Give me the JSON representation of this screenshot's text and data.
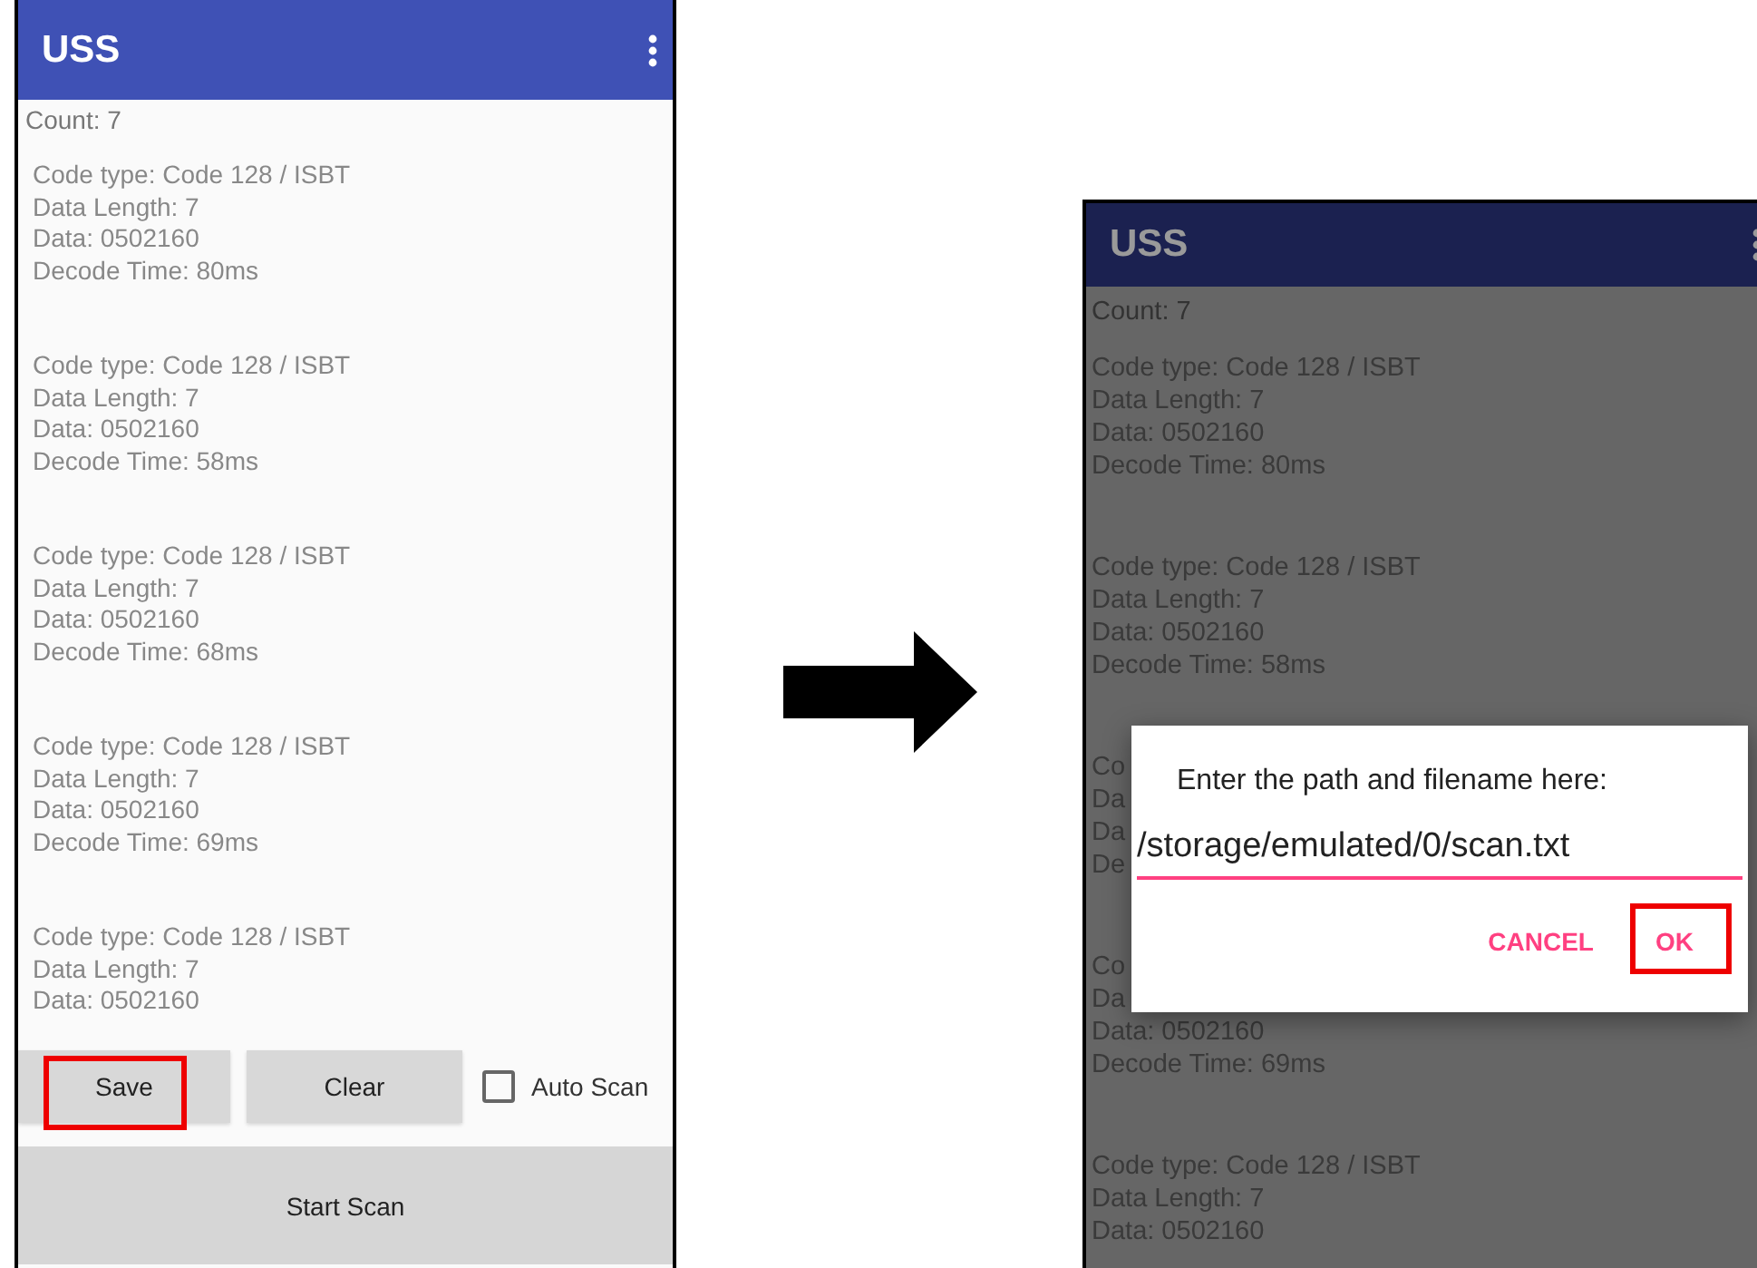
{
  "screens": [
    {
      "title": "USS",
      "dimmed": false,
      "count": "Count:  7",
      "records": [
        {
          "lines": [
            "Code type: Code 128 / ISBT",
            "Data Length: 7",
            "Data: 0502160",
            "Decode Time: 80ms"
          ]
        },
        {
          "lines": [
            "Code type: Code 128 / ISBT",
            "Data Length: 7",
            "Data: 0502160",
            "Decode Time: 58ms"
          ]
        },
        {
          "lines": [
            "Code type: Code 128 / ISBT",
            "Data Length: 7",
            "Data: 0502160",
            "Decode Time: 68ms"
          ]
        },
        {
          "lines": [
            "Code type: Code 128 / ISBT",
            "Data Length: 7",
            "Data: 0502160",
            "Decode Time: 69ms"
          ]
        },
        {
          "lines": [
            "Code type: Code 128 / ISBT",
            "Data Length: 7",
            "Data: 0502160"
          ]
        }
      ],
      "buttons": [
        {
          "label": "Save",
          "highlighted": true
        },
        {
          "label": "Clear",
          "highlighted": false
        }
      ],
      "auto_scan": {
        "label": "Auto Scan",
        "checked": false
      },
      "start_button": "Start Scan"
    },
    {
      "title": "USS",
      "dimmed": true,
      "count": "Count:  7",
      "records": [
        {
          "lines": [
            "Code type: Code 128 / ISBT",
            "Data Length: 7",
            "Data: 0502160",
            "Decode Time: 80ms"
          ]
        },
        {
          "lines": [
            "Code type: Code 128 / ISBT",
            "Data Length: 7",
            "Data: 0502160",
            "Decode Time: 58ms"
          ]
        },
        {
          "lines": [
            "Co",
            "Da",
            "Da",
            "De"
          ]
        },
        {
          "lines": [
            "Co",
            "Da",
            "Data: 0502160",
            "Decode Time: 69ms"
          ]
        },
        {
          "lines": [
            "Code type: Code 128 / ISBT",
            "Data Length: 7",
            "Data: 0502160"
          ]
        }
      ],
      "dialog": {
        "message": "Enter the path and filename here:",
        "value": "/storage/emulated/0/scan.txt",
        "buttons": [
          {
            "label": "CANCEL",
            "highlighted": false
          },
          {
            "label": "OK",
            "highlighted": true
          }
        ]
      }
    }
  ]
}
